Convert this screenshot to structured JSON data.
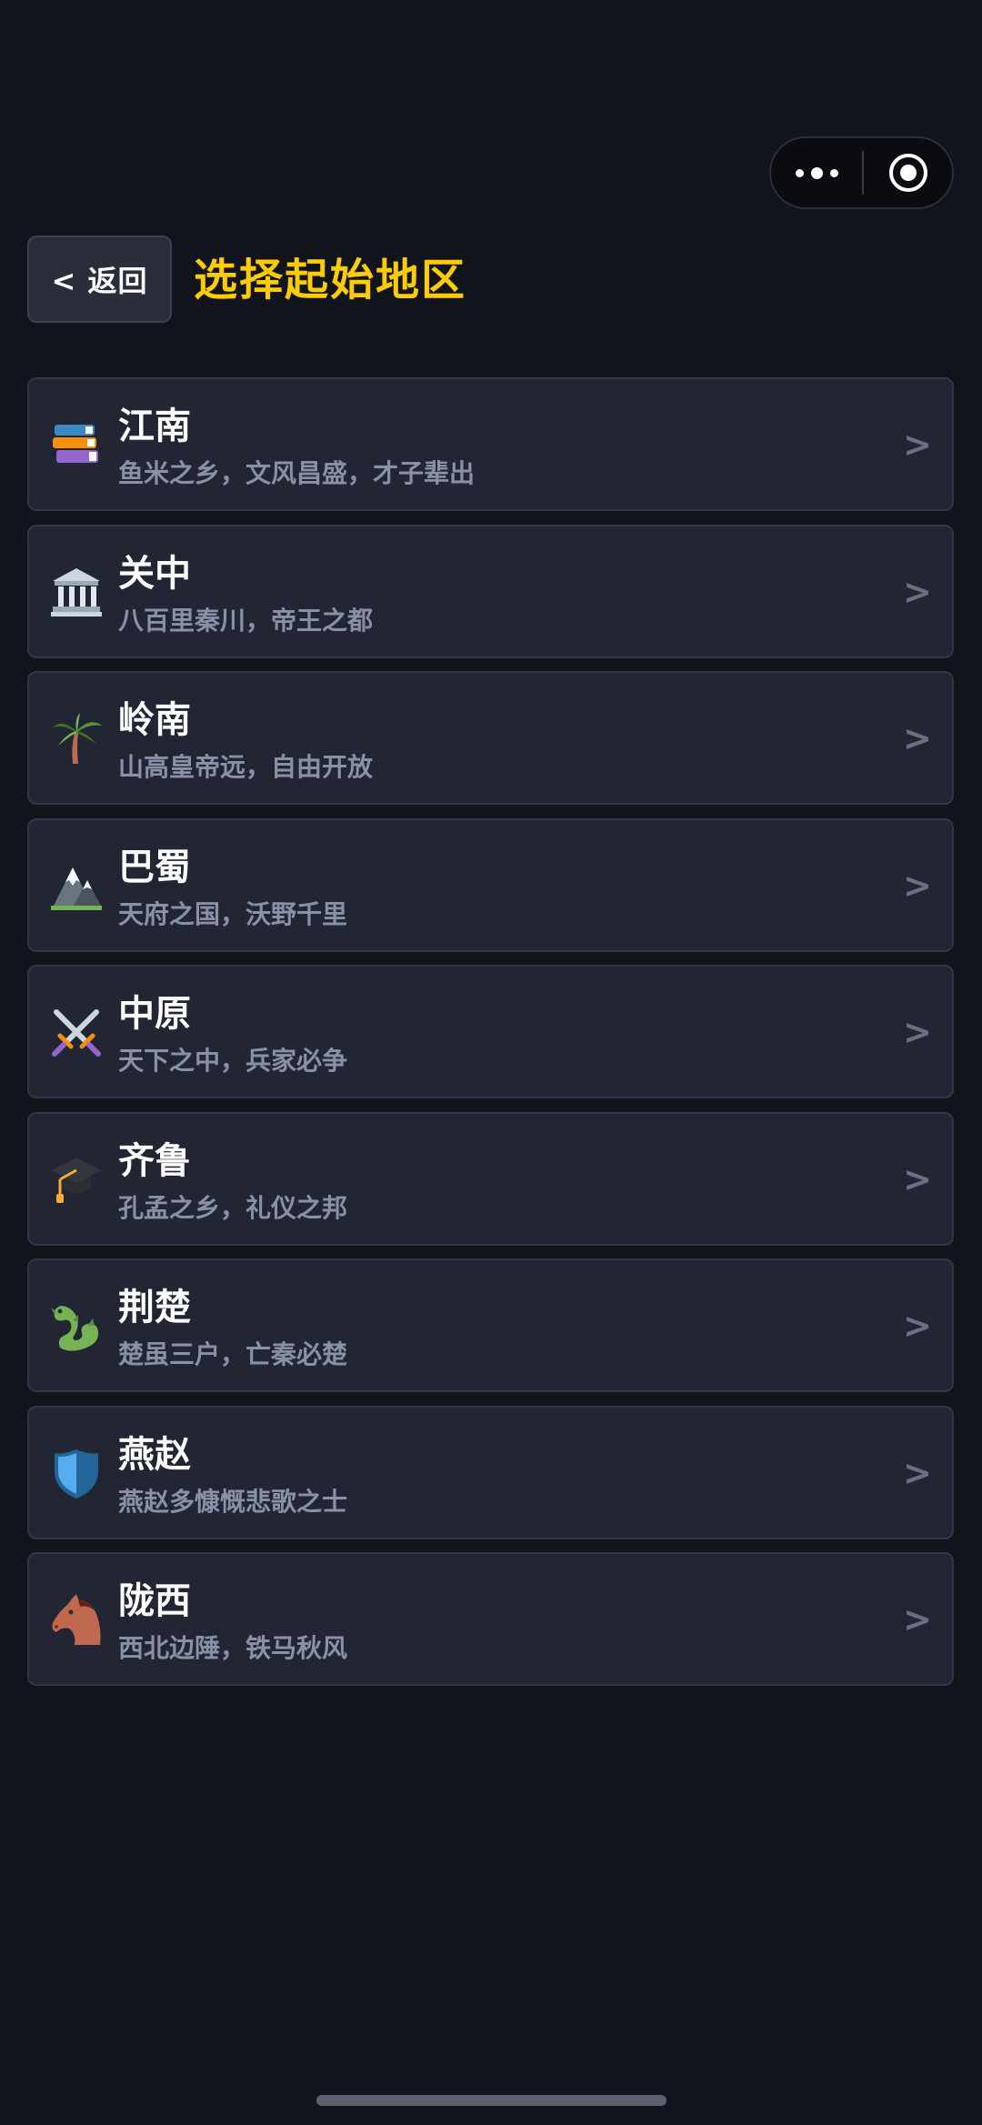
{
  "header": {
    "back_label": "< 返回",
    "title": "选择起始地区"
  },
  "capsule": {
    "more_icon": "more-dots-icon",
    "close_icon": "target-close-icon"
  },
  "regions": [
    {
      "name": "江南",
      "desc": "鱼米之乡，文风昌盛，才子辈出",
      "icon": "books-icon",
      "arrow": ">"
    },
    {
      "name": "关中",
      "desc": "八百里秦川，帝王之都",
      "icon": "classical-building-icon",
      "arrow": ">"
    },
    {
      "name": "岭南",
      "desc": "山高皇帝远，自由开放",
      "icon": "palm-tree-icon",
      "arrow": ">"
    },
    {
      "name": "巴蜀",
      "desc": "天府之国，沃野千里",
      "icon": "snow-mountain-icon",
      "arrow": ">"
    },
    {
      "name": "中原",
      "desc": "天下之中，兵家必争",
      "icon": "crossed-swords-icon",
      "arrow": ">"
    },
    {
      "name": "齐鲁",
      "desc": "孔孟之乡，礼仪之邦",
      "icon": "graduation-cap-icon",
      "arrow": ">"
    },
    {
      "name": "荆楚",
      "desc": "楚虽三户，亡秦必楚",
      "icon": "dragon-icon",
      "arrow": ">"
    },
    {
      "name": "燕赵",
      "desc": "燕赵多慷慨悲歌之士",
      "icon": "shield-icon",
      "arrow": ">"
    },
    {
      "name": "陇西",
      "desc": "西北边陲，铁马秋风",
      "icon": "horse-icon",
      "arrow": ">"
    }
  ]
}
